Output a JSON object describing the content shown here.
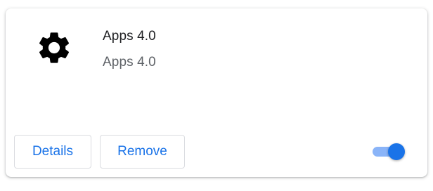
{
  "extension": {
    "name": "Apps 4.0",
    "description": "Apps 4.0",
    "icon": "gear-icon",
    "enabled": true
  },
  "actions": {
    "details_label": "Details",
    "remove_label": "Remove"
  },
  "colors": {
    "accent": "#1a73e8",
    "toggle_track": "#8ab4f8",
    "name_text": "#202124",
    "description_text": "#5f6368",
    "button_border": "#dadce0"
  }
}
